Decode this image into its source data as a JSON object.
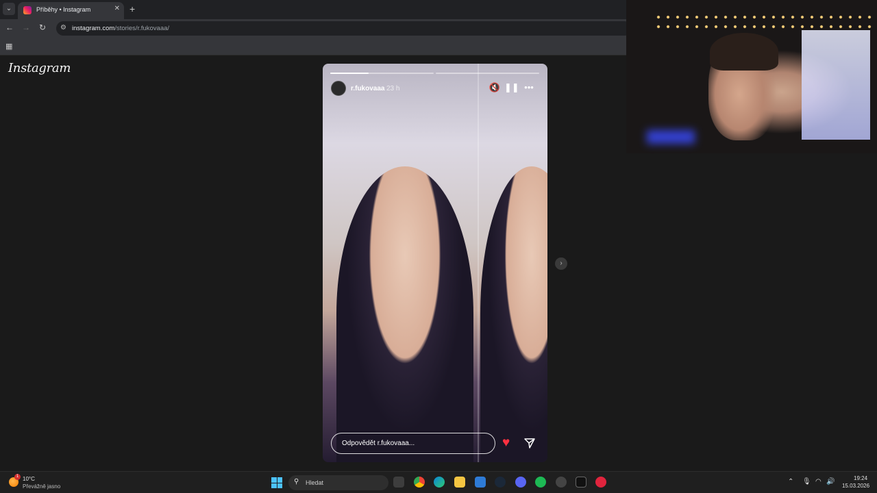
{
  "browser": {
    "tab_title": "Příběhy • Instagram",
    "close_symbol": "✕",
    "new_tab_symbol": "+",
    "url_host": "instagram.com",
    "url_path": "/stories/r.fukovaaa/"
  },
  "page": {
    "logo_text": "Instagram"
  },
  "story": {
    "username": "r.fukovaaa",
    "time_ago": "23 h",
    "progress": [
      0.37,
      0,
      0
    ],
    "reply_placeholder": "Odpovědět r.fukovaaa...",
    "controls": [
      "mute-icon",
      "pause-icon",
      "more-icon"
    ],
    "heart_color": "#ff3040"
  },
  "taskbar": {
    "weather_temp": "10°C",
    "weather_desc": "Převážně jasno",
    "weather_badge": "1",
    "search_placeholder": "Hledat",
    "time": "19:24",
    "date": "15.03.2026",
    "apps": [
      "file-explorer-icon",
      "chrome-icon",
      "edge-icon",
      "folder-icon",
      "notepad-icon",
      "steam-icon",
      "discord-icon",
      "spotify-icon",
      "app-icon",
      "capcut-icon",
      "opera-gx-icon"
    ]
  }
}
